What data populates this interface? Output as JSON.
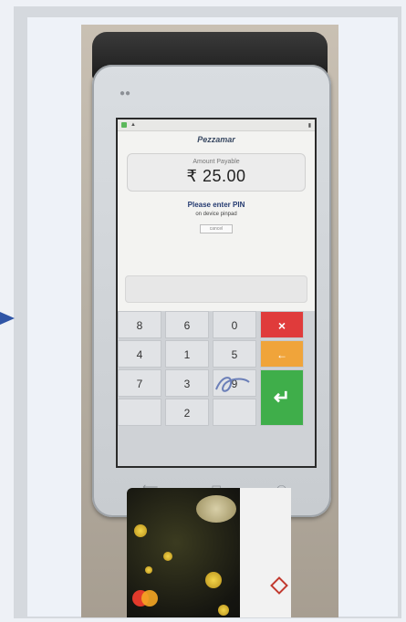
{
  "screen": {
    "brand": "Pezzamar",
    "amount_label": "Amount Payable",
    "amount_value": "₹ 25.00",
    "prompt_title": "Please enter PIN",
    "prompt_sub": "on device pinpad",
    "small_button_label": "cancel"
  },
  "keypad": {
    "keys": [
      {
        "id": "key-8",
        "label": "8"
      },
      {
        "id": "key-6",
        "label": "6"
      },
      {
        "id": "key-0",
        "label": "0"
      },
      {
        "id": "key-4",
        "label": "4"
      },
      {
        "id": "key-1",
        "label": "1"
      },
      {
        "id": "key-5",
        "label": "5"
      },
      {
        "id": "key-7",
        "label": "7"
      },
      {
        "id": "key-3",
        "label": "3"
      },
      {
        "id": "key-9",
        "label": "9"
      },
      {
        "id": "key-2",
        "label": "2"
      }
    ],
    "cancel_label": "×",
    "clear_label": "←",
    "enter_label": "↵"
  },
  "nav": {
    "back_icon": "⟵",
    "home_icon": "▭",
    "recent_icon": "⤺"
  },
  "colors": {
    "cancel": "#e03b3b",
    "clear": "#f0a43a",
    "enter": "#3fae4a",
    "arrow": "#2f55a6"
  }
}
